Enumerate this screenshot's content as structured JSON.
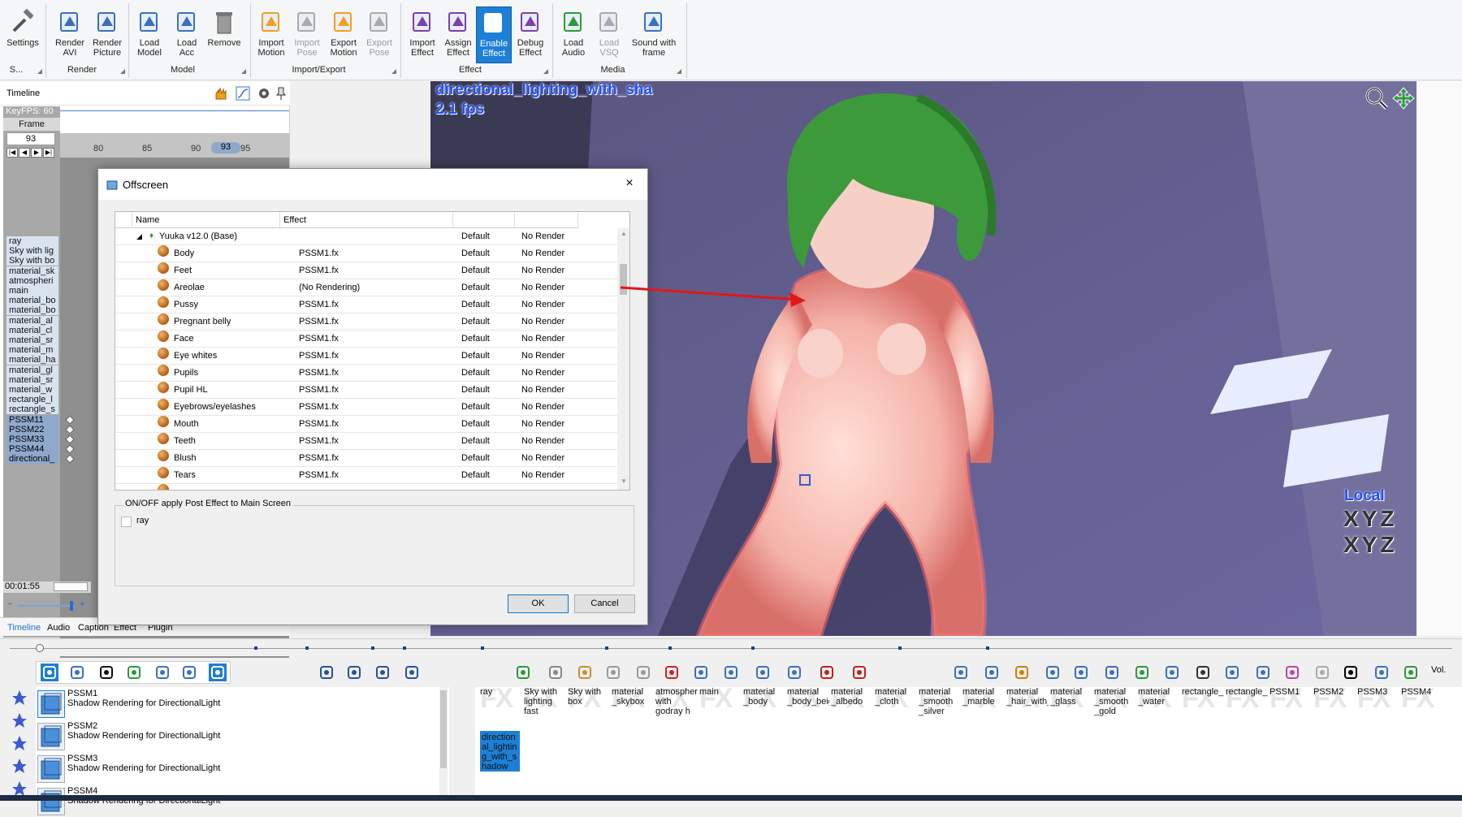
{
  "ribbon": {
    "buttons": [
      {
        "label": "Settings",
        "icon": "wrench-hammer-icon"
      },
      {
        "label": "Render AVI",
        "icon": "film-render-icon"
      },
      {
        "label": "Render Picture",
        "icon": "picture-render-icon"
      },
      {
        "label": "Load Model",
        "icon": "load-model-icon"
      },
      {
        "label": "Load Acc",
        "icon": "load-accessory-icon"
      },
      {
        "label": "Remove",
        "icon": "trash-icon"
      },
      {
        "label": "Import Motion",
        "icon": "import-motion-icon"
      },
      {
        "label": "Import Pose",
        "icon": "import-pose-icon"
      },
      {
        "label": "Export Motion",
        "icon": "export-motion-icon"
      },
      {
        "label": "Export Pose",
        "icon": "export-pose-icon"
      },
      {
        "label": "Import Effect",
        "icon": "import-effect-icon"
      },
      {
        "label": "Assign Effect",
        "icon": "assign-effect-icon"
      },
      {
        "label": "Enable Effect",
        "icon": "enable-effect-icon"
      },
      {
        "label": "Debug Effect",
        "icon": "debug-effect-icon"
      },
      {
        "label": "Load Audio",
        "icon": "load-audio-icon"
      },
      {
        "label": "Load VSQ",
        "icon": "load-vsq-icon"
      },
      {
        "label": "Sound with frame",
        "icon": "sound-frame-icon"
      }
    ],
    "groups": [
      "S...",
      "Render",
      "Model",
      "Import/Export",
      "Effect",
      "Media"
    ]
  },
  "timeline": {
    "title": "Timeline",
    "keyfps": "KeyFPS: 60",
    "frame_label": "Frame",
    "frame_value": "93",
    "ruler": [
      "80",
      "85",
      "90",
      "93",
      "95"
    ],
    "time": "00:01:55",
    "rows": [
      "ray",
      "Sky with lig",
      "Sky with bo",
      "material_sk",
      "atmospheri",
      "main",
      "material_bo",
      "material_bo",
      "material_al",
      "material_cl",
      "material_sr",
      "material_m",
      "material_ha",
      "material_gl",
      "material_sr",
      "material_w",
      "rectangle_l",
      "rectangle_s",
      "PSSM11",
      "PSSM22",
      "PSSM33",
      "PSSM44",
      "directional_"
    ],
    "tabs": [
      "Timeline",
      "Audio",
      "Caption",
      "Effect",
      "Plugin"
    ]
  },
  "viewport": {
    "effect_name": "directional_lighting_with_sha",
    "fps": "2.1 fps",
    "local": "Local",
    "axes": "XYZ"
  },
  "dialog": {
    "title": "Offscreen",
    "close": "×",
    "col_name": "Name",
    "col_effect": "Effect",
    "model": "Yuuka v12.0 (Base)",
    "default": "Default",
    "norender": "No Render",
    "rows": [
      {
        "name": "Body",
        "effect": "PSSM1.fx"
      },
      {
        "name": "Feet",
        "effect": "PSSM1.fx"
      },
      {
        "name": "Areolae",
        "effect": "(No Rendering)"
      },
      {
        "name": "Pussy",
        "effect": "PSSM1.fx"
      },
      {
        "name": "Pregnant belly",
        "effect": "PSSM1.fx"
      },
      {
        "name": "Face",
        "effect": "PSSM1.fx"
      },
      {
        "name": "Eye whites",
        "effect": "PSSM1.fx"
      },
      {
        "name": "Pupils",
        "effect": "PSSM1.fx"
      },
      {
        "name": "Pupil HL",
        "effect": "PSSM1.fx"
      },
      {
        "name": "Eyebrows/eyelashes",
        "effect": "PSSM1.fx"
      },
      {
        "name": "Mouth",
        "effect": "PSSM1.fx"
      },
      {
        "name": "Teeth",
        "effect": "PSSM1.fx"
      },
      {
        "name": "Blush",
        "effect": "PSSM1.fx"
      },
      {
        "name": "Tears",
        "effect": "PSSM1.fx"
      }
    ],
    "post_label": "ON/OFF apply Post Effect to Main Screen",
    "post_item": "ray",
    "ok": "OK",
    "cancel": "Cancel"
  },
  "effects_list": [
    {
      "name": "PSSM1",
      "desc": "Shadow Rendering for DirectionalLight"
    },
    {
      "name": "PSSM2",
      "desc": "Shadow Rendering for DirectionalLight"
    },
    {
      "name": "PSSM3",
      "desc": "Shadow Rendering for DirectionalLight"
    },
    {
      "name": "PSSM4",
      "desc": "Shadow Rendering for DirectionalLight"
    }
  ],
  "fx_cells": [
    "ray",
    "Sky with lighting fast",
    "Sky with box",
    "material _skybox",
    "atmospheric_fog with godray h",
    "main",
    "material _body",
    "material _body_beige_dark",
    "material _albedo",
    "material _cloth",
    "material _smooth _silver",
    "material _marble",
    "material _hair_with_anisotropy",
    "material _glass",
    "material _smooth _gold",
    "material _water",
    "rectangle_lighting_with_shadow_",
    "rectangle_shadow",
    "PSSM1",
    "PSSM2",
    "PSSM3",
    "PSSM4"
  ],
  "fx_selected": "directional_lighting_with_shadow",
  "fx_bg": "FX",
  "vol": "Vol."
}
